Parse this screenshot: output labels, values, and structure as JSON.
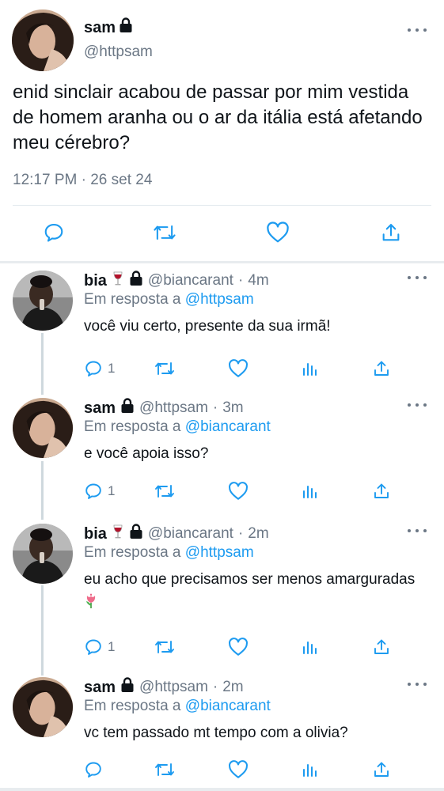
{
  "main_tweet": {
    "author_name": "sam",
    "handle": "@httpsam",
    "text": "enid sinclair acabou de passar por mim vestida de homem aranha ou o ar da itália está afetando meu cérebro?",
    "timestamp": "12:17 PM · 26 set 24",
    "actions": [
      "reply-icon",
      "retweet-icon",
      "like-icon",
      "share-icon"
    ]
  },
  "reply_to_prefix": "Em resposta a",
  "replies": [
    {
      "name": "bia",
      "handle": "@biancarant",
      "dot": "·",
      "time": "4m",
      "reply_to": "@httpsam",
      "text": "você viu certo, presente da sua irmã!",
      "reply_count": "1"
    },
    {
      "name": "sam",
      "handle": "@httpsam",
      "dot": "·",
      "time": "3m",
      "reply_to": "@biancarant",
      "text": "e você apoia isso?",
      "reply_count": "1"
    },
    {
      "name": "bia",
      "handle": "@biancarant",
      "dot": "·",
      "time": "2m",
      "reply_to": "@httpsam",
      "text": "eu acho que precisamos ser menos amarguradas",
      "reply_count": "1"
    },
    {
      "name": "sam",
      "handle": "@httpsam",
      "dot": "·",
      "time": "2m",
      "reply_to": "@biancarant",
      "text": "vc tem passado mt tempo com a olivia?",
      "reply_count": ""
    }
  ],
  "colors": {
    "text": "#0f1419",
    "secondary": "#6b7785",
    "link": "#1d9bf0",
    "divider": "#e1e8ed",
    "thread_line": "#cfd9de"
  }
}
